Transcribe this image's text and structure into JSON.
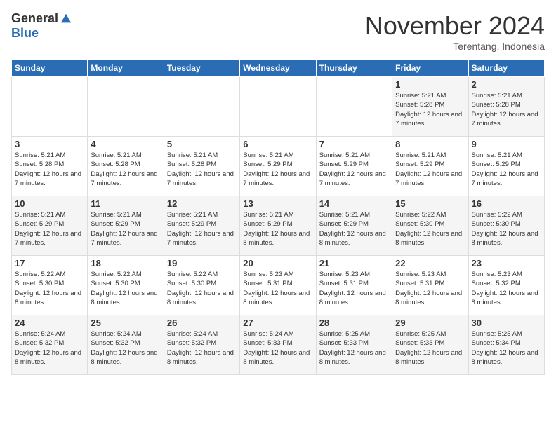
{
  "logo": {
    "general": "General",
    "blue": "Blue"
  },
  "header": {
    "month_title": "November 2024",
    "location": "Terentang, Indonesia"
  },
  "weekdays": [
    "Sunday",
    "Monday",
    "Tuesday",
    "Wednesday",
    "Thursday",
    "Friday",
    "Saturday"
  ],
  "weeks": [
    [
      {
        "day": "",
        "info": ""
      },
      {
        "day": "",
        "info": ""
      },
      {
        "day": "",
        "info": ""
      },
      {
        "day": "",
        "info": ""
      },
      {
        "day": "",
        "info": ""
      },
      {
        "day": "1",
        "info": "Sunrise: 5:21 AM\nSunset: 5:28 PM\nDaylight: 12 hours and 7 minutes."
      },
      {
        "day": "2",
        "info": "Sunrise: 5:21 AM\nSunset: 5:28 PM\nDaylight: 12 hours and 7 minutes."
      }
    ],
    [
      {
        "day": "3",
        "info": "Sunrise: 5:21 AM\nSunset: 5:28 PM\nDaylight: 12 hours and 7 minutes."
      },
      {
        "day": "4",
        "info": "Sunrise: 5:21 AM\nSunset: 5:28 PM\nDaylight: 12 hours and 7 minutes."
      },
      {
        "day": "5",
        "info": "Sunrise: 5:21 AM\nSunset: 5:28 PM\nDaylight: 12 hours and 7 minutes."
      },
      {
        "day": "6",
        "info": "Sunrise: 5:21 AM\nSunset: 5:29 PM\nDaylight: 12 hours and 7 minutes."
      },
      {
        "day": "7",
        "info": "Sunrise: 5:21 AM\nSunset: 5:29 PM\nDaylight: 12 hours and 7 minutes."
      },
      {
        "day": "8",
        "info": "Sunrise: 5:21 AM\nSunset: 5:29 PM\nDaylight: 12 hours and 7 minutes."
      },
      {
        "day": "9",
        "info": "Sunrise: 5:21 AM\nSunset: 5:29 PM\nDaylight: 12 hours and 7 minutes."
      }
    ],
    [
      {
        "day": "10",
        "info": "Sunrise: 5:21 AM\nSunset: 5:29 PM\nDaylight: 12 hours and 7 minutes."
      },
      {
        "day": "11",
        "info": "Sunrise: 5:21 AM\nSunset: 5:29 PM\nDaylight: 12 hours and 7 minutes."
      },
      {
        "day": "12",
        "info": "Sunrise: 5:21 AM\nSunset: 5:29 PM\nDaylight: 12 hours and 7 minutes."
      },
      {
        "day": "13",
        "info": "Sunrise: 5:21 AM\nSunset: 5:29 PM\nDaylight: 12 hours and 8 minutes."
      },
      {
        "day": "14",
        "info": "Sunrise: 5:21 AM\nSunset: 5:29 PM\nDaylight: 12 hours and 8 minutes."
      },
      {
        "day": "15",
        "info": "Sunrise: 5:22 AM\nSunset: 5:30 PM\nDaylight: 12 hours and 8 minutes."
      },
      {
        "day": "16",
        "info": "Sunrise: 5:22 AM\nSunset: 5:30 PM\nDaylight: 12 hours and 8 minutes."
      }
    ],
    [
      {
        "day": "17",
        "info": "Sunrise: 5:22 AM\nSunset: 5:30 PM\nDaylight: 12 hours and 8 minutes."
      },
      {
        "day": "18",
        "info": "Sunrise: 5:22 AM\nSunset: 5:30 PM\nDaylight: 12 hours and 8 minutes."
      },
      {
        "day": "19",
        "info": "Sunrise: 5:22 AM\nSunset: 5:30 PM\nDaylight: 12 hours and 8 minutes."
      },
      {
        "day": "20",
        "info": "Sunrise: 5:23 AM\nSunset: 5:31 PM\nDaylight: 12 hours and 8 minutes."
      },
      {
        "day": "21",
        "info": "Sunrise: 5:23 AM\nSunset: 5:31 PM\nDaylight: 12 hours and 8 minutes."
      },
      {
        "day": "22",
        "info": "Sunrise: 5:23 AM\nSunset: 5:31 PM\nDaylight: 12 hours and 8 minutes."
      },
      {
        "day": "23",
        "info": "Sunrise: 5:23 AM\nSunset: 5:32 PM\nDaylight: 12 hours and 8 minutes."
      }
    ],
    [
      {
        "day": "24",
        "info": "Sunrise: 5:24 AM\nSunset: 5:32 PM\nDaylight: 12 hours and 8 minutes."
      },
      {
        "day": "25",
        "info": "Sunrise: 5:24 AM\nSunset: 5:32 PM\nDaylight: 12 hours and 8 minutes."
      },
      {
        "day": "26",
        "info": "Sunrise: 5:24 AM\nSunset: 5:32 PM\nDaylight: 12 hours and 8 minutes."
      },
      {
        "day": "27",
        "info": "Sunrise: 5:24 AM\nSunset: 5:33 PM\nDaylight: 12 hours and 8 minutes."
      },
      {
        "day": "28",
        "info": "Sunrise: 5:25 AM\nSunset: 5:33 PM\nDaylight: 12 hours and 8 minutes."
      },
      {
        "day": "29",
        "info": "Sunrise: 5:25 AM\nSunset: 5:33 PM\nDaylight: 12 hours and 8 minutes."
      },
      {
        "day": "30",
        "info": "Sunrise: 5:25 AM\nSunset: 5:34 PM\nDaylight: 12 hours and 8 minutes."
      }
    ]
  ]
}
